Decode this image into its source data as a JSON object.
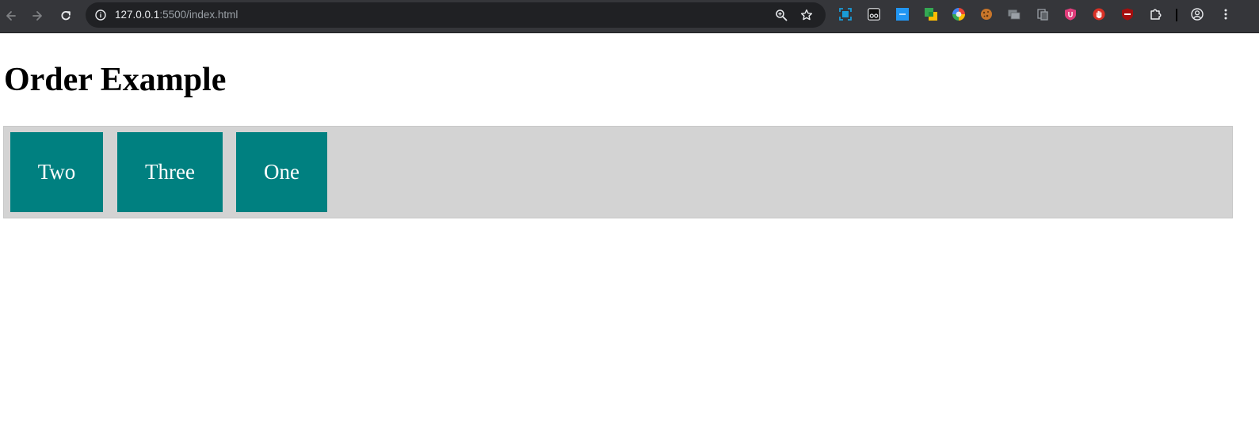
{
  "browser": {
    "url_host": "127.0.0.1",
    "url_rest": ":5500/index.html",
    "nav_icons": [
      "back-icon",
      "forward-icon",
      "reload-icon"
    ],
    "omnibox_icons": [
      "site-info-icon",
      "zoom-icon",
      "bookmark-star-icon"
    ],
    "extension_icons": [
      "screen-capture-icon",
      "eyes-icon",
      "blue-app-icon",
      "green-yellow-app-icon",
      "color-circle-icon",
      "cookie-icon",
      "tab-stack-icon",
      "clipboard-icon",
      "ublock-icon",
      "stop-hand-icon",
      "block-icon",
      "extensions-puzzle-icon",
      "profile-icon",
      "menu-kebab-icon"
    ],
    "colors": {
      "toolbar": "#35363a",
      "omnibox": "#202124",
      "url_host": "#e8eaed",
      "url_rest": "#9aa0a6"
    }
  },
  "page": {
    "title": "Order Example",
    "items": [
      "Two",
      "Three",
      "One"
    ],
    "colors": {
      "container": "#d3d3d3",
      "item": "#008080",
      "item_text": "#ffffff"
    }
  }
}
